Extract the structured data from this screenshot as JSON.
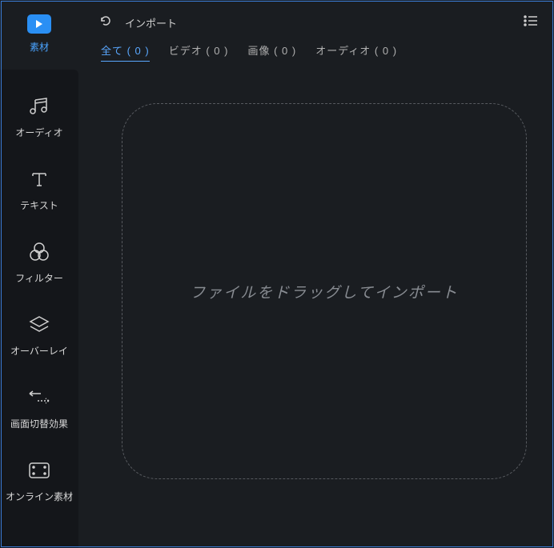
{
  "sidebar": {
    "media": {
      "label": "素材"
    },
    "items": [
      {
        "label": "オーディオ"
      },
      {
        "label": "テキスト"
      },
      {
        "label": "フィルター"
      },
      {
        "label": "オーバーレイ"
      },
      {
        "label": "画面切替効果"
      },
      {
        "label": "オンライン素材"
      }
    ]
  },
  "topbar": {
    "import_label": "インポート"
  },
  "tabs": {
    "all": "全て ( 0 )",
    "video": "ビデオ ( 0 )",
    "image": "画像 ( 0 )",
    "audio": "オーディオ ( 0 )"
  },
  "drop": {
    "message": "ファイルをドラッグしてインポート"
  }
}
